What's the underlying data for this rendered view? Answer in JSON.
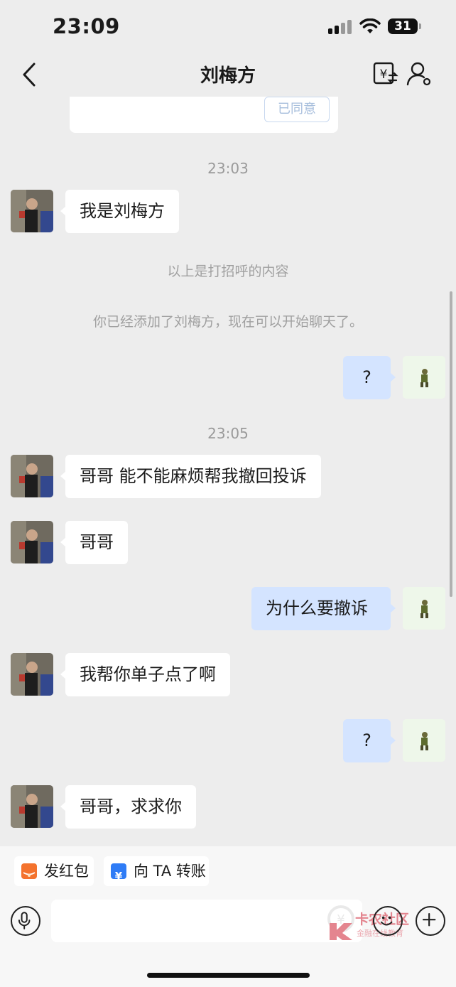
{
  "status_bar": {
    "time": "23:09",
    "battery": "31"
  },
  "header": {
    "title": "刘梅方"
  },
  "request_card": {
    "agree_label": "已同意"
  },
  "messages": [
    {
      "type": "time",
      "text": "23:03"
    },
    {
      "type": "in",
      "text": "我是刘梅方"
    },
    {
      "type": "system",
      "text": "以上是打招呼的内容"
    },
    {
      "type": "system",
      "text": "你已经添加了刘梅方，现在可以开始聊天了。"
    },
    {
      "type": "out",
      "text": "?"
    },
    {
      "type": "time",
      "text": "23:05"
    },
    {
      "type": "in",
      "text": "哥哥 能不能麻烦帮我撤回投诉"
    },
    {
      "type": "in",
      "text": "哥哥"
    },
    {
      "type": "out",
      "text": "为什么要撤诉"
    },
    {
      "type": "in",
      "text": "我帮你单子点了啊"
    },
    {
      "type": "out",
      "text": "?"
    },
    {
      "type": "in",
      "text": "哥哥，求求你"
    }
  ],
  "quick_actions": [
    {
      "label": "发红包",
      "icon": "red-packet-icon",
      "color": "#f4732e"
    },
    {
      "label": "向 TA 转账",
      "icon": "transfer-icon",
      "color": "#2f7cf6"
    }
  ],
  "input": {
    "placeholder": ""
  },
  "watermark": {
    "title": "卡农社区",
    "subtitle": "金融在线教育"
  },
  "colors": {
    "outgoing_bubble": "#d4e4ff",
    "incoming_bubble": "#ffffff",
    "background": "#ededed"
  }
}
